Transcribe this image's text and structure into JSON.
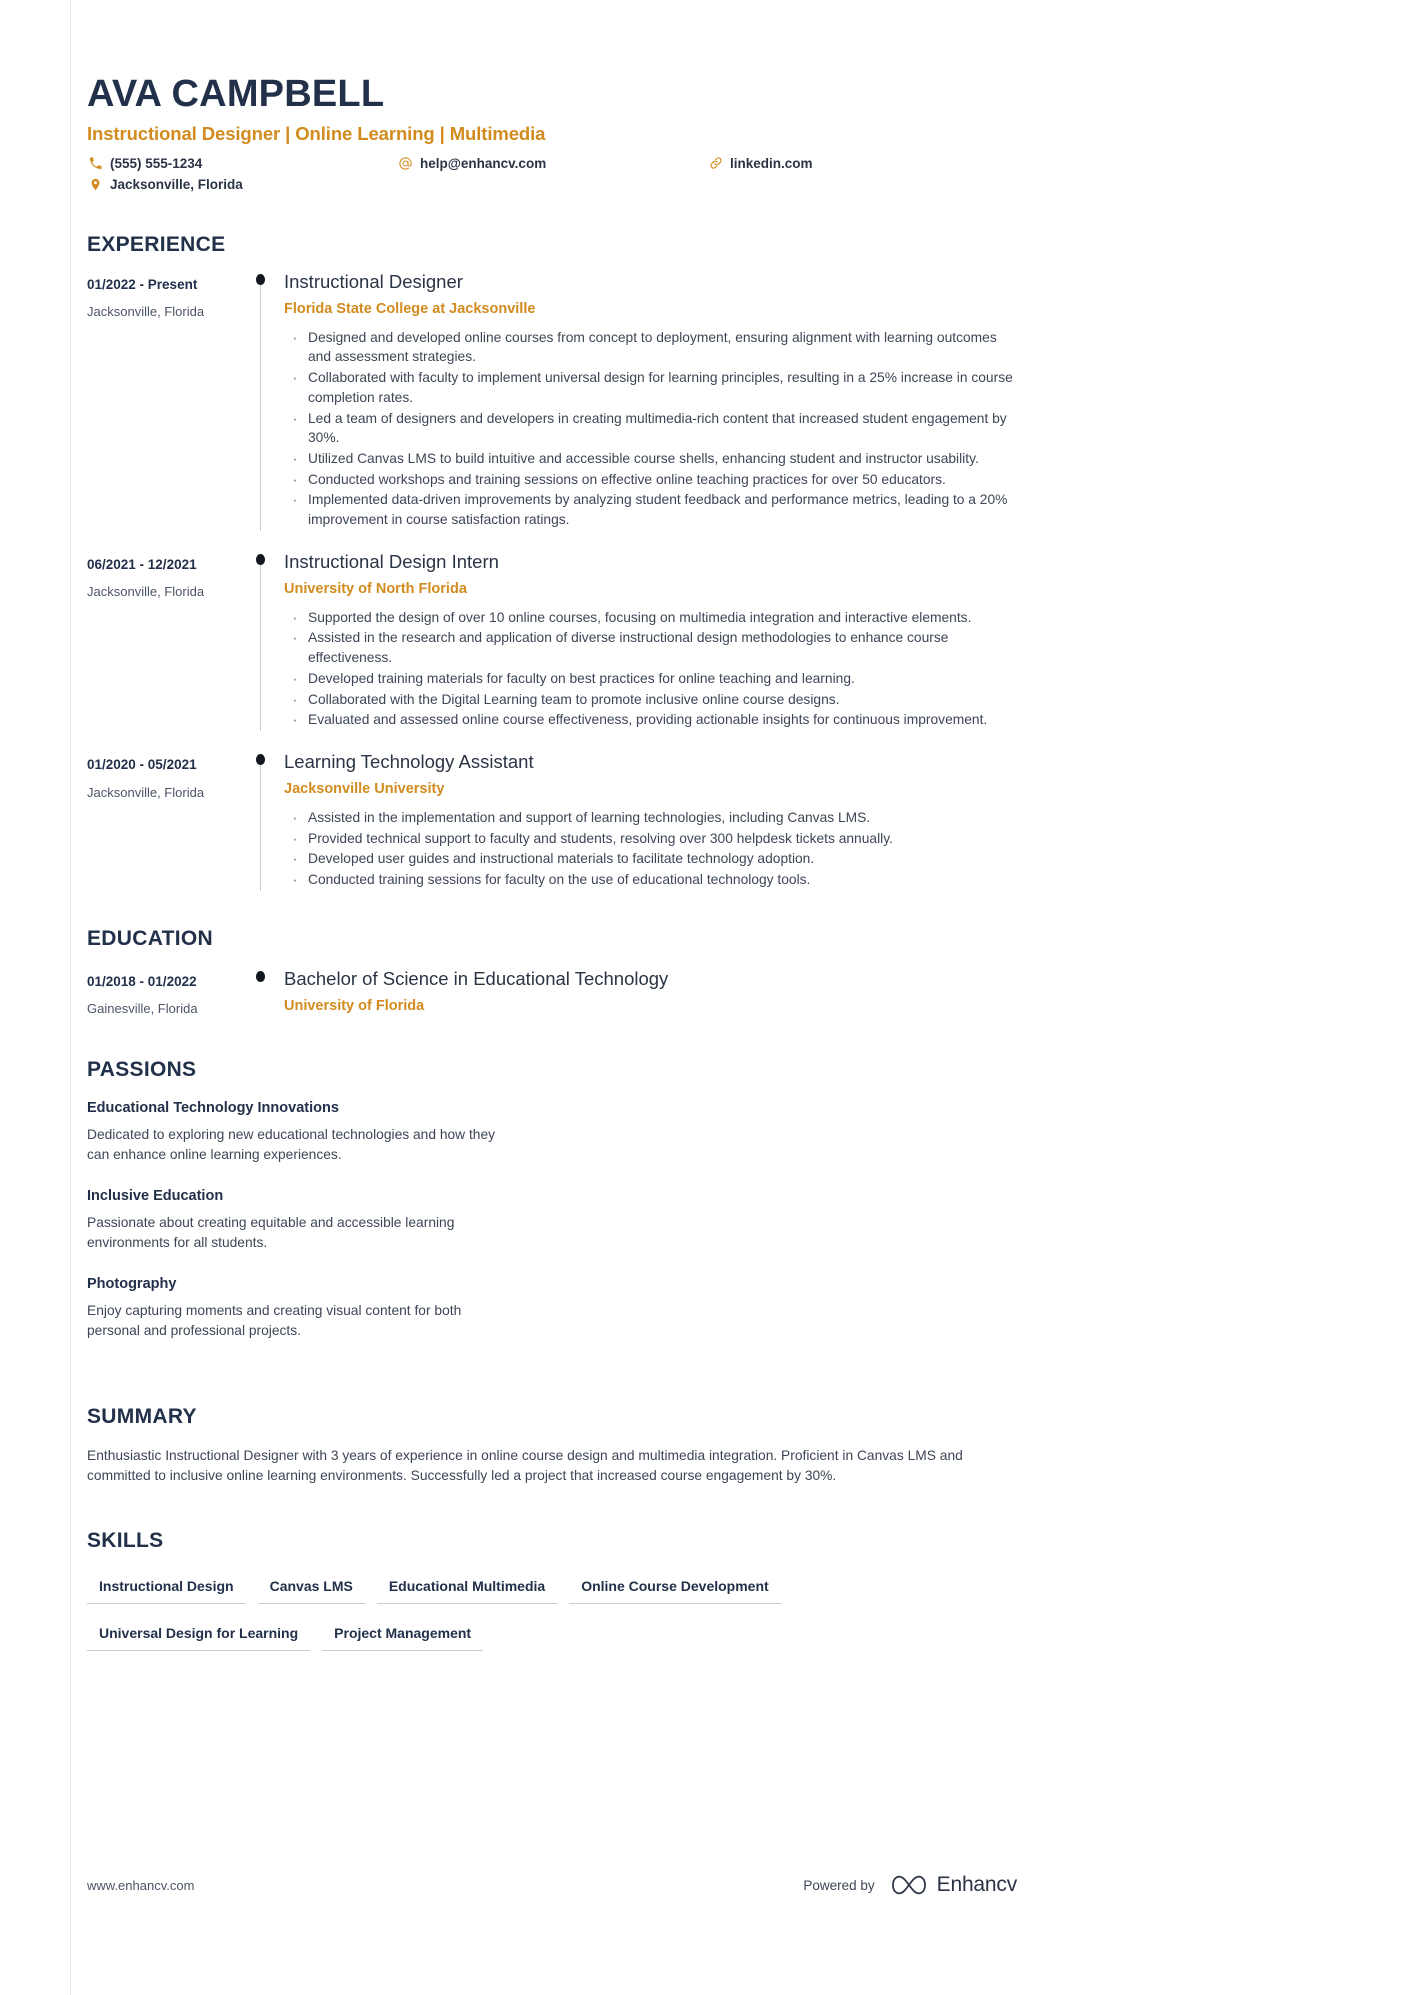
{
  "colors": {
    "accent": "#d18b1e",
    "heading": "#22304a",
    "body": "#3d4656",
    "rail": "#c9ccd3"
  },
  "header": {
    "name": "AVA CAMPBELL",
    "subtitle": "Instructional Designer | Online Learning | Multimedia",
    "contacts": {
      "phone": "(555) 555-1234",
      "email": "help@enhancv.com",
      "link": "linkedin.com",
      "location": "Jacksonville, Florida"
    }
  },
  "experience": {
    "title": "EXPERIENCE",
    "entries": [
      {
        "date": "01/2022 - Present",
        "location": "Jacksonville, Florida",
        "role": "Instructional Designer",
        "organization": "Florida State College at Jacksonville",
        "bullets": [
          "Designed and developed online courses from concept to deployment, ensuring alignment with learning outcomes and assessment strategies.",
          "Collaborated with faculty to implement universal design for learning principles, resulting in a 25% increase in course completion rates.",
          "Led a team of designers and developers in creating multimedia-rich content that increased student engagement by 30%.",
          "Utilized Canvas LMS to build intuitive and accessible course shells, enhancing student and instructor usability.",
          "Conducted workshops and training sessions on effective online teaching practices for over 50 educators.",
          "Implemented data-driven improvements by analyzing student feedback and performance metrics, leading to a 20% improvement in course satisfaction ratings."
        ]
      },
      {
        "date": "06/2021 - 12/2021",
        "location": "Jacksonville, Florida",
        "role": "Instructional Design Intern",
        "organization": "University of North Florida",
        "bullets": [
          "Supported the design of over 10 online courses, focusing on multimedia integration and interactive elements.",
          "Assisted in the research and application of diverse instructional design methodologies to enhance course effectiveness.",
          "Developed training materials for faculty on best practices for online teaching and learning.",
          "Collaborated with the Digital Learning team to promote inclusive online course designs.",
          "Evaluated and assessed online course effectiveness, providing actionable insights for continuous improvement."
        ]
      },
      {
        "date": "01/2020 - 05/2021",
        "location": "Jacksonville, Florida",
        "role": "Learning Technology Assistant",
        "organization": "Jacksonville University",
        "bullets": [
          "Assisted in the implementation and support of learning technologies, including Canvas LMS.",
          "Provided technical support to faculty and students, resolving over 300 helpdesk tickets annually.",
          "Developed user guides and instructional materials to facilitate technology adoption.",
          "Conducted training sessions for faculty on the use of educational technology tools."
        ]
      }
    ]
  },
  "education": {
    "title": "EDUCATION",
    "entries": [
      {
        "date": "01/2018 - 01/2022",
        "location": "Gainesville, Florida",
        "degree": "Bachelor of Science in Educational Technology",
        "institution": "University of Florida"
      }
    ]
  },
  "passions": {
    "title": "PASSIONS",
    "items": [
      {
        "name": "Educational Technology Innovations",
        "description": "Dedicated to exploring new educational technologies and how they\ncan enhance online learning experiences."
      },
      {
        "name": "Inclusive Education",
        "description": "Passionate about creating equitable and accessible learning\nenvironments for all students."
      },
      {
        "name": "Photography",
        "description": "Enjoy capturing moments and creating visual content for both\npersonal and professional projects."
      }
    ]
  },
  "summary": {
    "title": "SUMMARY",
    "text": "Enthusiastic Instructional Designer with 3 years of experience in online course design and multimedia integration. Proficient in Canvas LMS and committed to inclusive online learning environments. Successfully led a project that increased course engagement by 30%."
  },
  "skills": {
    "title": "SKILLS",
    "items": [
      "Instructional Design",
      "Canvas LMS",
      "Educational Multimedia",
      "Online Course Development",
      "Universal Design for Learning",
      "Project Management"
    ]
  },
  "footer": {
    "url": "www.enhancv.com",
    "powered_by": "Powered by",
    "brand": "Enhancv"
  }
}
